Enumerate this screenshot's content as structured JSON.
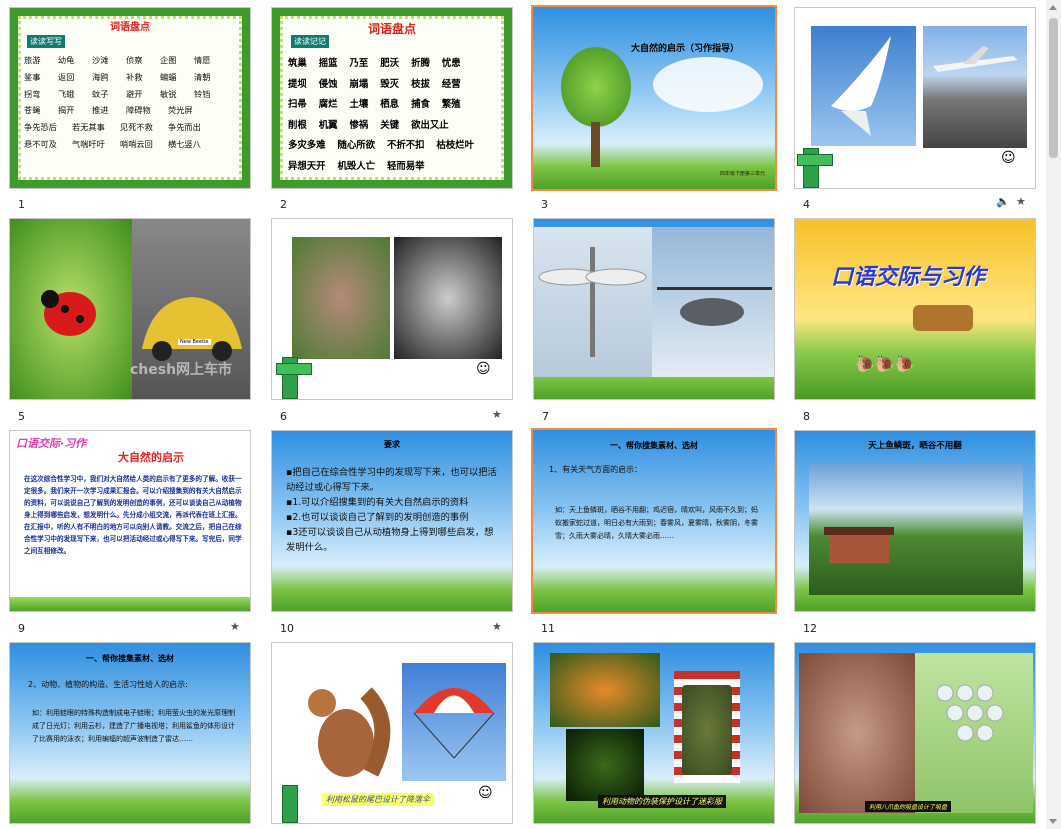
{
  "slides": [
    {
      "num": "1",
      "title": "词语盘点",
      "tag": "读读写写",
      "rows": [
        [
          "旅游",
          "幼龟",
          "沙滩",
          "侦察",
          "企图",
          "情愿"
        ],
        [
          "鉴事",
          "返回",
          "海鸥",
          "补救",
          "蝙蝠",
          "清朝"
        ],
        [
          "拐弯",
          "飞蛾",
          "蚊子",
          "避开",
          "敏锐",
          "铃铛"
        ],
        [
          "苍蝇",
          "揭开",
          "推进",
          "障碍物",
          "荧光屏"
        ],
        [
          "争先恐后",
          "若无其事",
          "见死不救",
          "争先而出"
        ],
        [
          "悬不可及",
          "气喘吁吁",
          "哨哨云回",
          "横七竖八"
        ]
      ]
    },
    {
      "num": "2",
      "title": "词语盘点",
      "tag": "读读记记",
      "rows": [
        [
          "筑巢",
          "摇篮",
          "乃至",
          "肥沃",
          "折腾",
          "忧患"
        ],
        [
          "提坝",
          "侵蚀",
          "崩塌",
          "毁灭",
          "枝拔",
          "经营"
        ],
        [
          "扫帚",
          "腐烂",
          "土壤",
          "栖息",
          "捕食",
          "繁殖"
        ],
        [
          "削根",
          "机翼",
          "惨祸",
          "关键",
          "欲出又止"
        ],
        [
          "多灾多难",
          "随心所欲",
          "不折不扣",
          "枯枝烂叶"
        ],
        [
          "异想天开",
          "机毁人亡",
          "轻而易举"
        ]
      ]
    },
    {
      "num": "3",
      "title": "大自然的启示（习作指导）",
      "footer": "四年级下册第三单元"
    },
    {
      "num": "4"
    },
    {
      "num": "5",
      "watermark": "chesh网上车市",
      "badge": "New Beetle"
    },
    {
      "num": "6"
    },
    {
      "num": "7"
    },
    {
      "num": "8",
      "title": "口语交际与习作"
    },
    {
      "num": "9",
      "logo": "口语交际·习作",
      "title": "大自然的启示",
      "body": "在这次综合性学习中，我们对大自然给人类的启示有了更多的了解。收获一定很多。我们来开一次学习成果汇报会。可以介绍搜集到的有关大自然启示的资料，可以说说自己了解到的发明创造的事例，还可以谈谈自己从动植物身上得到哪些启发，想发明什么。先分成小组交流，再派代表在班上汇报。在汇报中，听的人有不明白的地方可以向别人请教。交流之后，把自己在综合性学习中的发现写下来，也可以把活动经过或心得写下来。写完后，同学之间互相修改。"
    },
    {
      "num": "10",
      "heading": "要求",
      "items": [
        "把自己在综合性学习中的发现写下来，也可以把活动经过或心得写下来。",
        "1.可以介绍搜集到的有关大自然启示的资料",
        "2.也可以谈谈自己了解到的发明创造的事例",
        "3还可以谈谈自己从动植物身上得到哪些启发，想发明什么。"
      ]
    },
    {
      "num": "11",
      "heading": "一、帮你搜集素材、选材",
      "sub": "1、有关天气方面的启示：",
      "body": "如：天上鱼鳞斑，晒谷不用翻；鸡迟宿，晴欢叫，风雨不久到；蚂蚁搬家蛇过道，明日必有大雨到；春雾风，夏雾晴，秋雾阴，冬雾雪；久雨大雾必晴，久晴大雾必雨……"
    },
    {
      "num": "12",
      "heading": "天上鱼鳞斑，晒谷不用翻"
    },
    {
      "num": "",
      "heading": "一、帮你搜集素材、选材",
      "sub": "2、动物、植物的构造、生活习性给人的启示:",
      "body": "如：利用蛙眼的特殊构造制成电子蛙眼；利用萤火虫的发光原理制成了日光灯；利用云杉，建造了广播电视塔；利用鲨鱼的体形设计了比赛用的泳衣；利用蝙蝠的超声波制造了雷达……"
    },
    {
      "num": "",
      "caption": "利用松鼠的尾巴设计了降落伞"
    },
    {
      "num": "",
      "caption": "利用动物的伪装保护设计了迷彩服"
    },
    {
      "num": "",
      "caption": "利用八爪鱼的吸盘设计了吸盘"
    }
  ],
  "colors": {
    "accent": "#f08a4b",
    "vine": "#3f9a2c",
    "title_red": "#e02020"
  }
}
